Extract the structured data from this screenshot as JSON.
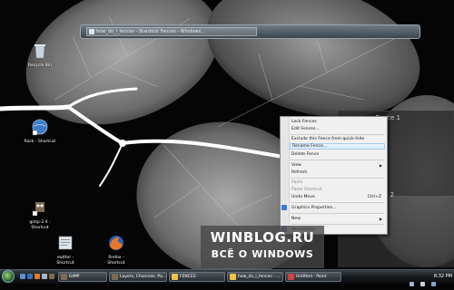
{
  "window": {
    "address": "how_do_i_fences - Stardock Fences - Windows..."
  },
  "desktop_icons": [
    {
      "label": "Recycle Bin",
      "icon": "recycle-bin-icon"
    },
    {
      "label": "Rock - Shortcut",
      "icon": "globe-shortcut-icon"
    },
    {
      "label": "gimp-2.4 - Shortcut",
      "icon": "gimp-icon"
    },
    {
      "label": "switter - Shortcut",
      "icon": "app-shortcut-icon"
    },
    {
      "label": "firefox - Shortcut",
      "icon": "firefox-icon"
    }
  ],
  "fences": {
    "panel1_title": "Fence 1",
    "panel2_title": "2"
  },
  "context_menu": {
    "items": [
      {
        "label": "Lock Fences"
      },
      {
        "label": "Edit Fences..."
      },
      {
        "label": "Exclude this Fence from quick-hide"
      },
      {
        "label": "Rename Fence..."
      },
      {
        "label": "Delete Fence"
      },
      {
        "label": "View"
      },
      {
        "label": "Refresh"
      },
      {
        "label": "Paste"
      },
      {
        "label": "Paste Shortcut"
      },
      {
        "label": "Undo Move",
        "shortcut": "Ctrl+Z"
      },
      {
        "label": "Graphics Properties..."
      },
      {
        "label": "New"
      },
      {
        "label": "Personalize"
      }
    ]
  },
  "watermark": {
    "line1": "WINBLOG.RU",
    "line2": "ВСЁ О WINDOWS"
  },
  "taskbar": {
    "tasks": [
      {
        "label": "GIMP"
      },
      {
        "label": "Layers, Channels, Pa..."
      },
      {
        "label": "FENCES"
      },
      {
        "label": "how_do_i_fences - ..."
      },
      {
        "label": "Untitled - Paint"
      }
    ],
    "clock": "8:32 PM"
  },
  "colors": {
    "menu_highlight": "#d6e8fa",
    "desktop_bg": "#050505"
  }
}
